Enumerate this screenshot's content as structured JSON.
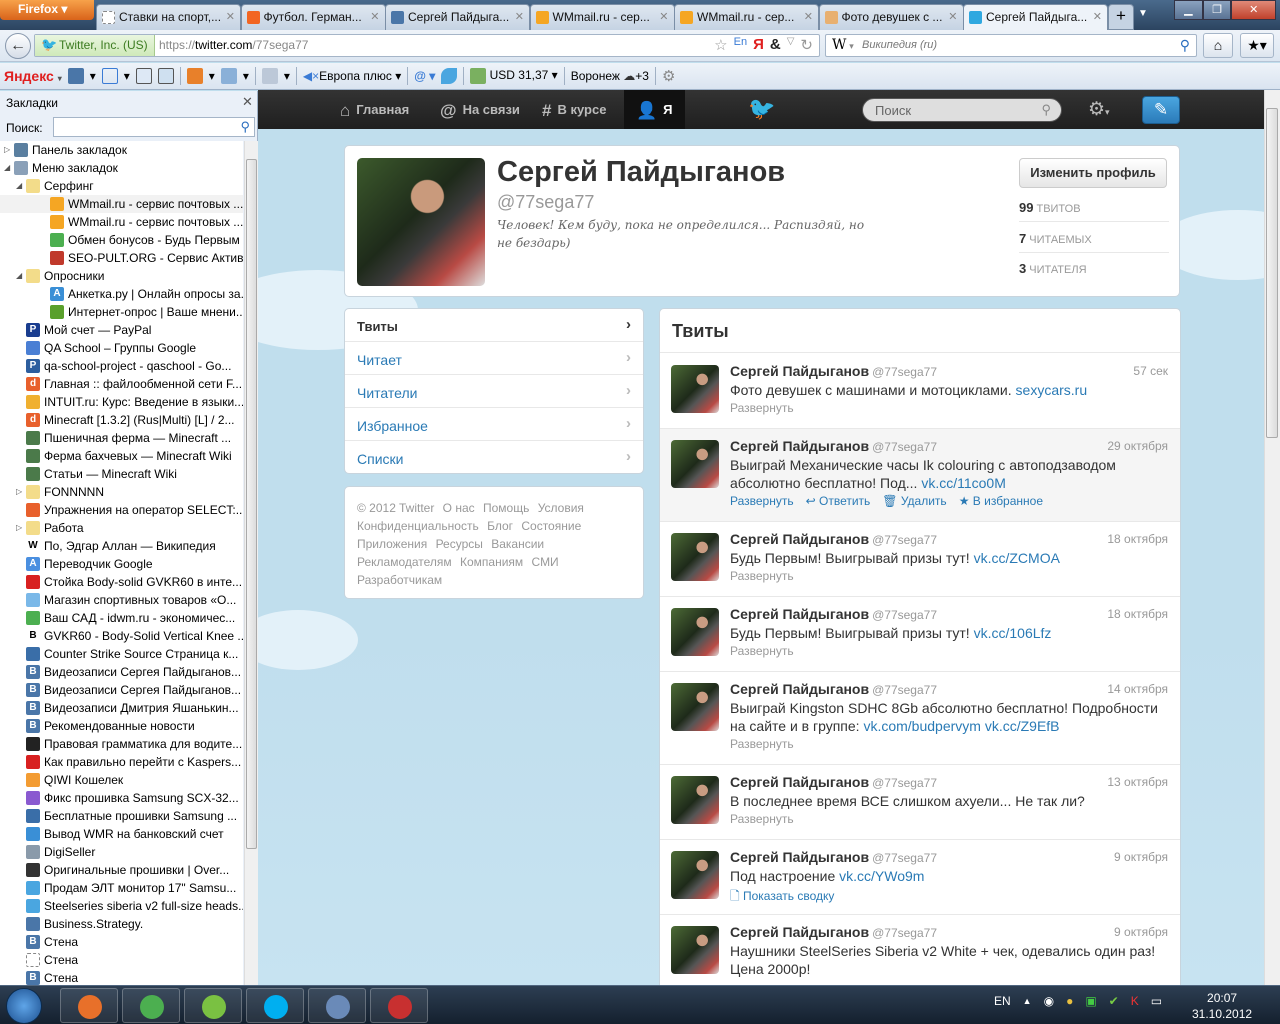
{
  "browser": {
    "menu_button": "Firefox",
    "tabs": [
      {
        "title": "Ставки на спорт,...",
        "icon": "dotted-page-icon",
        "color": "#ffffff"
      },
      {
        "title": "Футбол. Герман...",
        "icon": "championat-icon",
        "color": "#f26522"
      },
      {
        "title": "Сергей Пайдыга...",
        "icon": "vk-icon",
        "color": "#4a76a8"
      },
      {
        "title": "WMmail.ru - сер...",
        "icon": "wmmail-icon",
        "color": "#f5a623"
      },
      {
        "title": "WMmail.ru - сер...",
        "icon": "wmmail-icon",
        "color": "#f5a623"
      },
      {
        "title": "Фото девушек с ...",
        "icon": "cartoon-face-icon",
        "color": "#e8b070"
      },
      {
        "title": "Сергей Пайдыга...",
        "icon": "twitter-bird-icon",
        "color": "#2fa8e0",
        "active": true
      }
    ],
    "new_tab": "+",
    "identity": "Twitter, Inc. (US)",
    "url_prefix": "https://",
    "url_host": "twitter.com",
    "url_path": "/77sega77",
    "search_engine": "W",
    "search_placeholder": "Википедия (ru)",
    "yandex_bar": {
      "logo": "Яндекс",
      "radio": "Европа плюс",
      "currency": "USD 31,37",
      "weather_city": "Воронеж",
      "weather_temp": "+3"
    }
  },
  "sidebar": {
    "title": "Закладки",
    "search_label": "Поиск:",
    "items": [
      {
        "label": "Панель закладок",
        "level": 0,
        "exp": "▷",
        "icon": "bookmarks-toolbar-icon",
        "color": "#5a7fa0"
      },
      {
        "label": "Меню закладок",
        "level": 0,
        "exp": "◢",
        "icon": "bookmarks-menu-icon",
        "color": "#8aa0b8"
      },
      {
        "label": "Серфинг",
        "level": 1,
        "exp": "◢",
        "icon": "folder-icon",
        "color": "#f3dc8a"
      },
      {
        "label": "WMmail.ru - сервис почтовых ...",
        "level": 2,
        "icon": "wmmail-icon",
        "color": "#f5a623",
        "hl": true
      },
      {
        "label": "WMmail.ru - сервис почтовых ...",
        "level": 2,
        "icon": "wmmail-icon",
        "color": "#f5a623"
      },
      {
        "label": "Обмен бонусов - Будь Первым",
        "level": 2,
        "icon": "target-icon",
        "color": "#4caf50"
      },
      {
        "label": "SEO-PULT.ORG - Сервис Актив...",
        "level": 2,
        "icon": "bar-chart-icon",
        "color": "#c0392b"
      },
      {
        "label": "Опросники",
        "level": 1,
        "exp": "◢",
        "icon": "folder-icon",
        "color": "#f3dc8a"
      },
      {
        "label": "Анкетка.ру | Онлайн опросы за...",
        "level": 2,
        "icon": "anketka-icon",
        "color": "#3a8fd6",
        "glyph": "A"
      },
      {
        "label": "Интернет-опрос | Ваше мнени...",
        "level": 2,
        "icon": "arrow-icon",
        "color": "#5aa02c"
      },
      {
        "label": "Мой счет — PayPal",
        "level": 1,
        "icon": "paypal-icon",
        "color": "#1a3d8f",
        "glyph": "P"
      },
      {
        "label": "QA School – Группы Google",
        "level": 1,
        "icon": "google-groups-icon",
        "color": "#4a7fd4"
      },
      {
        "label": "qa-school-project - qaschool - Go...",
        "level": 1,
        "icon": "project-icon",
        "color": "#2d5e9e",
        "glyph": "P"
      },
      {
        "label": "Главная :: файлообменной сети F...",
        "level": 1,
        "icon": "depositfiles-icon",
        "color": "#e8602c",
        "glyph": "d"
      },
      {
        "label": "INTUIT.ru: Курс: Введение в языки...",
        "level": 1,
        "icon": "intuit-icon",
        "color": "#f0b030"
      },
      {
        "label": "Minecraft [1.3.2] (Rus|Multi) [L] / 2...",
        "level": 1,
        "icon": "depositfiles-icon",
        "color": "#e8602c",
        "glyph": "d"
      },
      {
        "label": "Пшеничная ферма — Minecraft ...",
        "level": 1,
        "icon": "minecraft-icon",
        "color": "#4b7a4a"
      },
      {
        "label": "Ферма бахчевых — Minecraft Wiki",
        "level": 1,
        "icon": "minecraft-icon",
        "color": "#4b7a4a"
      },
      {
        "label": "Статьи — Minecraft Wiki",
        "level": 1,
        "icon": "minecraft-icon",
        "color": "#4b7a4a"
      },
      {
        "label": "FONNNNN",
        "level": 1,
        "exp": "▷",
        "icon": "folder-icon",
        "color": "#f3dc8a"
      },
      {
        "label": "Упражнения на оператор SELECT:...",
        "level": 1,
        "icon": "target-icon",
        "color": "#e8602c"
      },
      {
        "label": "Работа",
        "level": 1,
        "exp": "▷",
        "icon": "folder-icon",
        "color": "#f3dc8a"
      },
      {
        "label": "По, Эдгар Аллан — Википедия",
        "level": 1,
        "icon": "wikipedia-icon",
        "color": "#ffffff",
        "glyph": "W"
      },
      {
        "label": "Переводчик Google",
        "level": 1,
        "icon": "google-translate-icon",
        "color": "#4a8fe0",
        "glyph": "A"
      },
      {
        "label": "Стойка Body-solid GVKR60 в инте...",
        "level": 1,
        "icon": "power-icon",
        "color": "#d82020"
      },
      {
        "label": "Магазин спортивных товаров «О...",
        "level": 1,
        "icon": "bird-icon",
        "color": "#7ab8e8"
      },
      {
        "label": "Ваш САД - idwm.ru - экономичес...",
        "level": 1,
        "icon": "leaf-icon",
        "color": "#4caf50"
      },
      {
        "label": "GVKR60 - Body-Solid Vertical Knee ...",
        "level": 1,
        "icon": "b-logo-icon",
        "color": "#ffffff",
        "glyph": "B"
      },
      {
        "label": "Counter Strike Source  Страница к...",
        "level": 1,
        "icon": "counter-strike-icon",
        "color": "#3a6ea8"
      },
      {
        "label": "Видеозаписи Сергея Пайдыганов...",
        "level": 1,
        "icon": "vk-icon",
        "color": "#4a76a8",
        "glyph": "B"
      },
      {
        "label": "Видеозаписи Сергея Пайдыганов...",
        "level": 1,
        "icon": "vk-icon",
        "color": "#4a76a8",
        "glyph": "B"
      },
      {
        "label": "Видеозаписи Дмитрия Яшанькин...",
        "level": 1,
        "icon": "vk-icon",
        "color": "#4a76a8",
        "glyph": "B"
      },
      {
        "label": "Рекомендованные новости",
        "level": 1,
        "icon": "vk-icon",
        "color": "#4a76a8",
        "glyph": "B"
      },
      {
        "label": "Правовая грамматика для водите...",
        "level": 1,
        "icon": "joomla-icon",
        "color": "#222222"
      },
      {
        "label": "Как правильно перейти с Kaspers...",
        "level": 1,
        "icon": "kaspersky-icon",
        "color": "#d82020"
      },
      {
        "label": "QIWI Кошелек",
        "level": 1,
        "icon": "qiwi-icon",
        "color": "#f39c33"
      },
      {
        "label": "Фикс прошивка Samsung SCX-32...",
        "level": 1,
        "icon": "pinwheel-icon",
        "color": "#8a5ad0"
      },
      {
        "label": "Бесплатные прошивки Samsung ...",
        "level": 1,
        "icon": "pencil-icon",
        "color": "#3a6ea8"
      },
      {
        "label": "Вывод WMR на банковский счет",
        "level": 1,
        "icon": "webmoney-icon",
        "color": "#3a8fd6"
      },
      {
        "label": "DigiSeller",
        "level": 1,
        "icon": "digiseller-icon",
        "color": "#8a9aaa"
      },
      {
        "label": "Оригинальные прошивки | Over...",
        "level": 1,
        "icon": "chip-icon",
        "color": "#333333"
      },
      {
        "label": "Продам ЭЛТ монитор 17\" Samsu...",
        "level": 1,
        "icon": "chat-bubble-icon",
        "color": "#4aa6e0"
      },
      {
        "label": "Steelseries siberia v2 full-size heads...",
        "level": 1,
        "icon": "chat-bubble-icon",
        "color": "#4aa6e0"
      },
      {
        "label": "Business.Strategy.",
        "level": 1,
        "icon": "comment-icon",
        "color": "#4a76a8"
      },
      {
        "label": "Стена",
        "level": 1,
        "icon": "vk-icon",
        "color": "#4a76a8",
        "glyph": "B"
      },
      {
        "label": "Стена",
        "level": 1,
        "icon": "dotted-page-icon",
        "color": "#ffffff"
      },
      {
        "label": "Стена",
        "level": 1,
        "icon": "vk-icon",
        "color": "#4a76a8",
        "glyph": "B"
      }
    ]
  },
  "twitter": {
    "nav": [
      {
        "label": "Главная",
        "icon": "home-icon",
        "glyph": "⌂"
      },
      {
        "label": "На связи",
        "icon": "at-icon",
        "glyph": "@"
      },
      {
        "label": "В курсе",
        "icon": "hashtag-icon",
        "glyph": "#"
      },
      {
        "label": "Я",
        "icon": "user-icon",
        "glyph": "👤",
        "active": true
      }
    ],
    "search_placeholder": "Поиск",
    "profile": {
      "name": "Сергей Пайдыганов",
      "handle": "@77sega77",
      "bio": "Человек! Кем буду, пока не определился... Распиздяй, но не бездарь)",
      "edit_button": "Изменить профиль",
      "stats": [
        {
          "value": "99",
          "label": "твитов"
        },
        {
          "value": "7",
          "label": "читаемых"
        },
        {
          "value": "3",
          "label": "читателя"
        }
      ]
    },
    "left_nav": [
      "Твиты",
      "Читает",
      "Читатели",
      "Избранное",
      "Списки"
    ],
    "footer": [
      "© 2012 Twitter",
      "О нас",
      "Помощь",
      "Условия",
      "Конфиденциальность",
      "Блог",
      "Состояние",
      "Приложения",
      "Ресурсы",
      "Вакансии",
      "Рекламодателям",
      "Компаниям",
      "СМИ",
      "Разработчикам"
    ],
    "stream_title": "Твиты",
    "tweets": [
      {
        "name": "Сергей Пайдыганов",
        "handle": "@77sega77",
        "time": "57 сек",
        "text": "Фото девушек с машинами и мотоциклами.",
        "link": "sexycars.ru",
        "actions": [
          "Развернуть"
        ]
      },
      {
        "name": "Сергей Пайдыганов",
        "handle": "@77sega77",
        "time": "29 октября",
        "text": "Выиграй Механические часы Ik colouring с автоподзаводом абсолютно бесплатно! Под...",
        "link": "vk.cc/11co0M",
        "actions": [
          "Развернуть",
          "↩ Ответить",
          "🗑 Удалить",
          "★ В избранное"
        ],
        "hover": true
      },
      {
        "name": "Сергей Пайдыганов",
        "handle": "@77sega77",
        "time": "18 октября",
        "text": "Будь Первым! Выигрывай призы тут!",
        "link": "vk.cc/ZCMOA",
        "actions": [
          "Развернуть"
        ]
      },
      {
        "name": "Сергей Пайдыганов",
        "handle": "@77sega77",
        "time": "18 октября",
        "text": "Будь Первым! Выигрывай призы тут!",
        "link": "vk.cc/106Lfz",
        "actions": [
          "Развернуть"
        ]
      },
      {
        "name": "Сергей Пайдыганов",
        "handle": "@77sega77",
        "time": "14 октября",
        "text": "Выиграй Kingston SDHC 8Gb абсолютно бесплатно! Подробности на сайте и в группе:",
        "link": "vk.com/budpervym vk.cc/Z9EfB",
        "actions": [
          "Развернуть"
        ]
      },
      {
        "name": "Сергей Пайдыганов",
        "handle": "@77sega77",
        "time": "13 октября",
        "text": "В последнее время ВСЕ слишком ахуели... Не так ли?",
        "link": "",
        "actions": [
          "Развернуть"
        ]
      },
      {
        "name": "Сергей Пайдыганов",
        "handle": "@77sega77",
        "time": "9 октября",
        "text": "Под настроение",
        "link": "vk.cc/YWo9m",
        "actions": [
          "🗋 Показать сводку"
        ],
        "blue": true
      },
      {
        "name": "Сергей Пайдыганов",
        "handle": "@77sega77",
        "time": "9 октября",
        "text": "Наушники SteelSeries Siberia v2 White + чек, одевались один раз! Цена 2000р!",
        "link": "",
        "actions": []
      }
    ]
  },
  "taskbar": {
    "lang": "EN",
    "time": "20:07",
    "date": "31.10.2012",
    "apps": [
      {
        "name": "firefox",
        "color": "#e8702a"
      },
      {
        "name": "chrome",
        "color": "#4caf50"
      },
      {
        "name": "network-meter",
        "color": "#7ac142"
      },
      {
        "name": "skype",
        "color": "#00aff0"
      },
      {
        "name": "virtualbox",
        "color": "#6a8ab8"
      },
      {
        "name": "paint",
        "color": "#c83030"
      }
    ]
  }
}
